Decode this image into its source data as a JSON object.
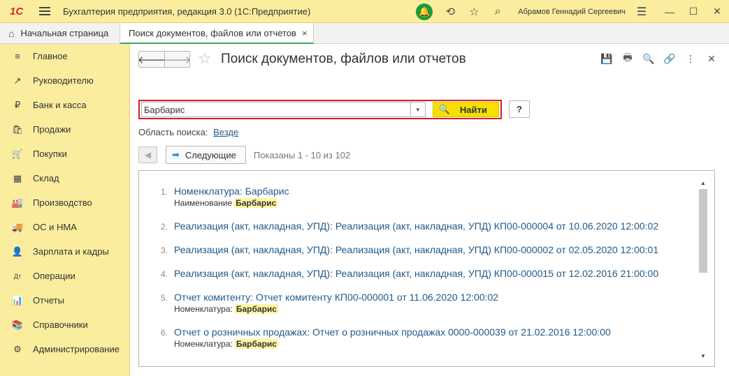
{
  "titlebar": {
    "logo": "1С",
    "app_title": "Бухгалтерия предприятия, редакция 3.0  (1С:Предприятие)",
    "user_name": "Абрамов Геннадий Сергеевич"
  },
  "tabs": {
    "home_label": "Начальная страница",
    "doc_label": "Поиск документов, файлов или отчетов",
    "close": "×"
  },
  "sidebar": {
    "items": [
      {
        "label": "Главное",
        "icon": "≡"
      },
      {
        "label": "Руководителю",
        "icon": "↗"
      },
      {
        "label": "Банк и касса",
        "icon": "₽"
      },
      {
        "label": "Продажи",
        "icon": "🛍"
      },
      {
        "label": "Покупки",
        "icon": "🛒"
      },
      {
        "label": "Склад",
        "icon": "▦"
      },
      {
        "label": "Производство",
        "icon": "🏭"
      },
      {
        "label": "ОС и НМА",
        "icon": "🚚"
      },
      {
        "label": "Зарплата и кадры",
        "icon": "👤"
      },
      {
        "label": "Операции",
        "icon": "Дт"
      },
      {
        "label": "Отчеты",
        "icon": "📊"
      },
      {
        "label": "Справочники",
        "icon": "📚"
      },
      {
        "label": "Администрирование",
        "icon": "⚙"
      }
    ]
  },
  "main": {
    "page_title": "Поиск документов, файлов или отчетов",
    "search": {
      "value": "Барбарис",
      "find_label": "Найти",
      "help_label": "?"
    },
    "scope": {
      "label": "Область поиска:",
      "link": "Везде"
    },
    "pager": {
      "next_label": "Следующие",
      "shown": "Показаны 1 - 10 из 102"
    },
    "results": [
      {
        "num": "1.",
        "link": "Номенклатура: Барбарис",
        "sub_label": "Наименование",
        "sub_value": "Барбарис"
      },
      {
        "num": "2.",
        "link": "Реализация (акт, накладная, УПД): Реализация (акт, накладная, УПД) КП00-000004 от 10.06.2020 12:00:02",
        "sub_label": "",
        "sub_value": ""
      },
      {
        "num": "3.",
        "link": "Реализация (акт, накладная, УПД): Реализация (акт, накладная, УПД) КП00-000002 от 02.05.2020 12:00:01",
        "sub_label": "",
        "sub_value": ""
      },
      {
        "num": "4.",
        "link": "Реализация (акт, накладная, УПД): Реализация (акт, накладная, УПД) КП00-000015 от 12.02.2016 21:00:00",
        "sub_label": "",
        "sub_value": ""
      },
      {
        "num": "5.",
        "link": "Отчет комитенту: Отчет комитенту КП00-000001 от 11.06.2020 12:00:02",
        "sub_label": "Номенклатура:",
        "sub_value": "Барбарис"
      },
      {
        "num": "6.",
        "link": "Отчет о розничных продажах: Отчет о розничных продажах 0000-000039 от 21.02.2016 12:00:00",
        "sub_label": "Номенклатура:",
        "sub_value": "Барбарис"
      }
    ]
  },
  "colors": {
    "panel_yellow": "#fbed9e",
    "link_blue": "#1f5a8a",
    "find_yellow": "#f5e000",
    "highlight_red": "#d01f25",
    "notification_green": "#1e9a3a"
  }
}
